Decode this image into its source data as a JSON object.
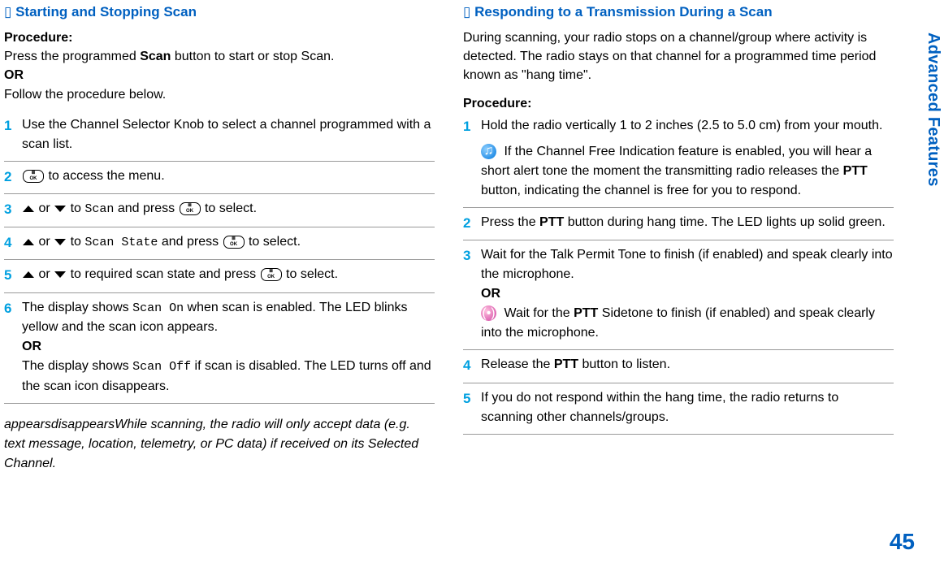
{
  "sidebar": {
    "title": "Advanced Features"
  },
  "page_number": "45",
  "left": {
    "title": "Starting and Stopping Scan",
    "procedure_label": "Procedure",
    "intro_1": "Press the programmed ",
    "intro_1_bold": "Scan",
    "intro_1_after": " button to start or stop Scan.",
    "or": "OR",
    "intro_2": "Follow the procedure below.",
    "key_label": "OK",
    "steps": [
      {
        "num": "1",
        "text": "Use the Channel Selector Knob to select a channel programmed with a scan list."
      },
      {
        "num": "2",
        "after_icon": " to access the menu."
      },
      {
        "num": "3",
        "or_to": " or ",
        "to": " to ",
        "target": "Scan",
        "and_press": " and press ",
        "to_select": " to select."
      },
      {
        "num": "4",
        "or_to": " or ",
        "to": " to ",
        "target": "Scan State",
        "and_press": " and press ",
        "to_select": " to select."
      },
      {
        "num": "5",
        "or_to": " or ",
        "to_text": " to required scan state and press ",
        "to_select": " to select."
      },
      {
        "num": "6",
        "t1": "The display shows ",
        "mono1": "Scan On",
        "t2": " when scan is enabled. The LED blinks yellow and the scan icon appears.",
        "or": "OR",
        "t3": "The display shows ",
        "mono2": "Scan Off",
        "t4": " if scan is disabled. The LED turns off and the scan icon disappears."
      }
    ],
    "note": "appearsdisappearsWhile scanning, the radio will only accept data (e.g. text message, location, telemetry, or PC data) if received on its Selected Channel."
  },
  "right": {
    "title": "Responding to a Transmission During a Scan",
    "intro": "During scanning, your radio stops on a channel/group where activity is detected. The radio stays on that channel for a programmed time period known as \"hang time\".",
    "procedure_label": "Procedure:",
    "steps": {
      "s1": {
        "num": "1",
        "text": "Hold the radio vertically 1 to 2 inches (2.5 to 5.0 cm) from your mouth.",
        "icon_text": " If the Channel Free Indication feature is enabled, you will hear a short alert tone the moment the transmitting radio releases the ",
        "bold1": "PTT",
        "after1": " button, indicating the channel is free for you to respond."
      },
      "s2": {
        "num": "2",
        "t1": "Press the ",
        "bold": "PTT",
        "t2": " button during hang time. The LED lights up solid green."
      },
      "s3": {
        "num": "3",
        "t1": "Wait for the Talk Permit Tone to finish (if enabled) and speak clearly into the microphone.",
        "or": "OR",
        "icon_t1": " Wait for the ",
        "bold": "PTT",
        "icon_t2": " Sidetone to finish (if enabled) and speak clearly into the microphone."
      },
      "s4": {
        "num": "4",
        "t1": "Release the ",
        "bold": "PTT",
        "t2": " button to listen."
      },
      "s5": {
        "num": "5",
        "t1": "If you do not respond within the hang time, the radio returns to scanning other channels/groups."
      }
    }
  }
}
